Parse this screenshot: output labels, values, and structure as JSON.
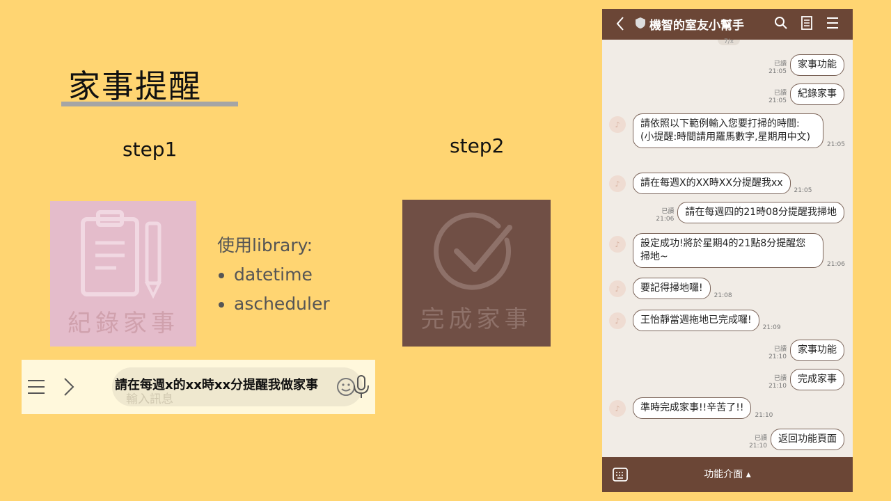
{
  "slide": {
    "title": "家事提醒",
    "step1": "step1",
    "step2": "step2",
    "library_label": "使用library:",
    "libraries": [
      "datetime",
      "ascheduler"
    ],
    "tile_record_caption": "紀錄家事",
    "tile_done_caption": "完成家事"
  },
  "input_bar": {
    "typed_text": "請在每週x的xx時xx分提醒我做家事",
    "placeholder": "輸入訊息"
  },
  "phone": {
    "title": "機智的室友小幫手",
    "partial_top": "7/x",
    "messages": [
      {
        "dir": "out",
        "read": "已讀",
        "time": "21:05",
        "text": "家事功能"
      },
      {
        "dir": "out",
        "read": "已讀",
        "time": "21:05",
        "text": "紀錄家事"
      },
      {
        "dir": "in",
        "time": "21:05",
        "text": "請依照以下範例輸入您要打掃的時間:\n(小提醒:時間請用羅馬數字,星期用中文)"
      },
      {
        "dir": "in",
        "time": "21:05",
        "text": "請在每週X的XX時XX分提醒我xx"
      },
      {
        "dir": "out",
        "read": "已讀",
        "time": "21:06",
        "text": "請在每週四的21時08分提醒我掃地"
      },
      {
        "dir": "in",
        "time": "21:06",
        "text": "設定成功!將於星期4的21點8分提醒您\n掃地~"
      },
      {
        "dir": "in",
        "time": "21:08",
        "text": "要記得掃地囉!"
      },
      {
        "dir": "in",
        "time": "21:09",
        "text": "王怡靜當週拖地已完成囉!"
      },
      {
        "dir": "out",
        "read": "已讀",
        "time": "21:10",
        "text": "家事功能"
      },
      {
        "dir": "out",
        "read": "已讀",
        "time": "21:10",
        "text": "完成家事"
      },
      {
        "dir": "in",
        "time": "21:10",
        "text": "準時完成家事!!辛苦了!!"
      },
      {
        "dir": "out",
        "read": "已讀",
        "time": "21:10",
        "text": "返回功能頁面"
      }
    ],
    "footer_label": "功能介面 ▴"
  },
  "colors": {
    "background": "#FFD572",
    "phone_bar": "#6B4636",
    "tile_record": "#E4BCCB",
    "tile_done": "#704F45"
  }
}
